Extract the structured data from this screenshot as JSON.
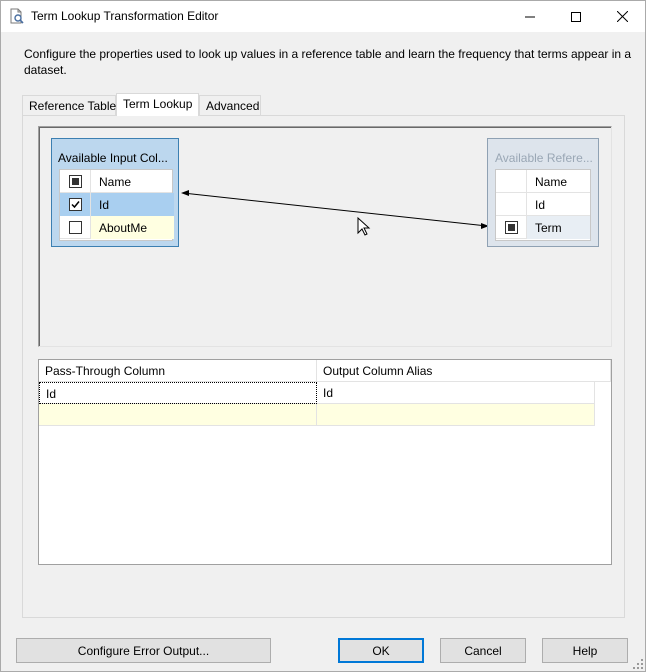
{
  "window": {
    "title": "Term Lookup Transformation Editor",
    "description": "Configure the properties used to look up values in a reference table and learn the frequency that terms appear in a dataset."
  },
  "tabs": [
    {
      "label": "Reference Table",
      "active": false
    },
    {
      "label": "Term Lookup",
      "active": true
    },
    {
      "label": "Advanced",
      "active": false
    }
  ],
  "input_columns": {
    "title": "Available Input Col...",
    "header": "Name",
    "header_checked": "indeterminate",
    "rows": [
      {
        "name": "Id",
        "checked": true,
        "selected": true
      },
      {
        "name": "AboutMe",
        "checked": false,
        "selected": false
      }
    ]
  },
  "reference_columns": {
    "title": "Available Refere...",
    "header": "Name",
    "rows": [
      {
        "name": "Id",
        "checked": false
      },
      {
        "name": "Term",
        "checked": "indeterminate"
      }
    ]
  },
  "mapping": {
    "from": "Id",
    "to": "Term"
  },
  "passthrough": {
    "columns": [
      "Pass-Through Column",
      "Output Column Alias"
    ],
    "rows": [
      [
        "Id",
        "Id"
      ]
    ]
  },
  "buttons": {
    "configure_error": "Configure Error Output...",
    "ok": "OK",
    "cancel": "Cancel",
    "help": "Help"
  },
  "colors": {
    "selection": "#a9cff0",
    "new_row": "#ffffe1",
    "accent": "#0078d7"
  }
}
